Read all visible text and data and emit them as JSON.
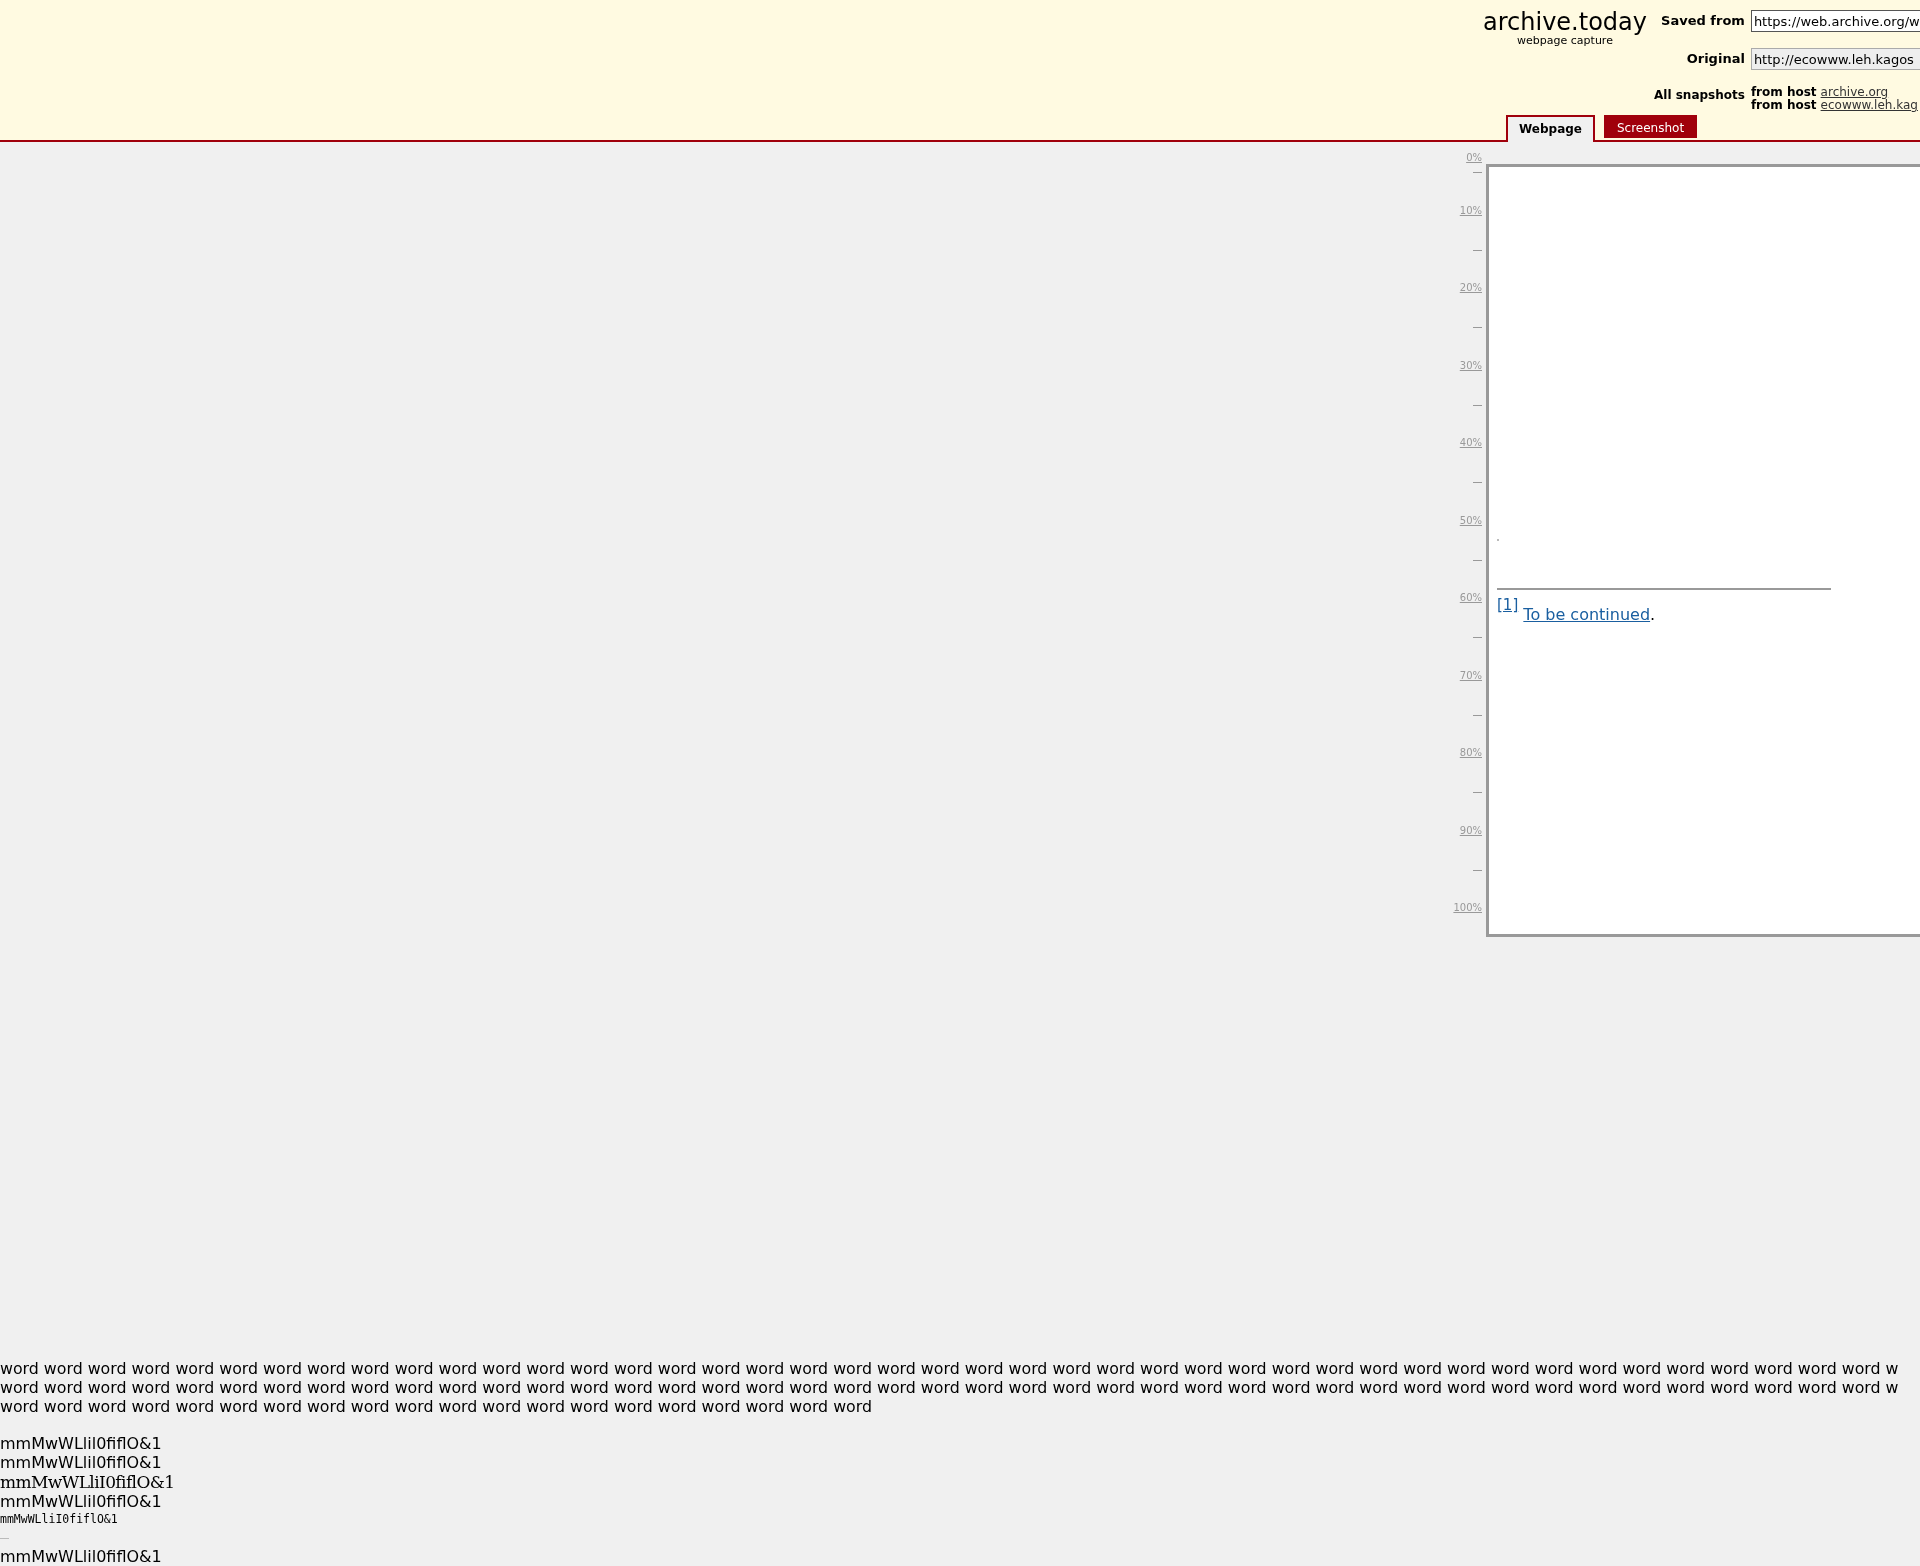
{
  "header": {
    "logo": "archive.today",
    "tagline": "webpage capture",
    "fields": [
      {
        "label": "Saved from",
        "value": "https://web.archive.org/w",
        "disabled": false
      },
      {
        "label": "Original",
        "value": "http://ecowww.leh.kagos",
        "disabled": true
      }
    ],
    "snapshots": {
      "label": "All snapshots",
      "hosts": [
        {
          "prefix": "from host",
          "link": "archive.org"
        },
        {
          "prefix": "from host",
          "link": "ecowww.leh.kag"
        }
      ]
    }
  },
  "tabs": [
    {
      "label": "Webpage",
      "selected": true
    },
    {
      "label": "Screenshot",
      "selected": false
    }
  ],
  "ruler": [
    "0%",
    "10%",
    "20%",
    "30%",
    "40%",
    "50%",
    "60%",
    "70%",
    "80%",
    "90%",
    "100%"
  ],
  "page": {
    "footnote_ref": "[1]",
    "footnote_link": "To be continued",
    "footnote_end": "."
  },
  "text_lines": [
    "word word word word word word word word word word word word word word word word word word word word word word word word word word word word word word word word word word word word word word word word word word word w",
    "word word word word word word word word word word word word word word word word word word word word word word word word word word word word word word word word word word word word word word word word word word word w",
    "word word word word word word word word word word word word word word word word word word word word"
  ],
  "font_samples": [
    {
      "kind": "sans",
      "text": "mmMwWLlil0fiflO&1"
    },
    {
      "kind": "sans",
      "text": "mmMwWLlil0fiflO&1"
    },
    {
      "kind": "serif",
      "text": "mmMwWLliI0fiflO&1"
    },
    {
      "kind": "sans",
      "text": "mmMwWLlil0fiflO&1"
    },
    {
      "kind": "mono",
      "text": "mmMwWLliI0fiflO&1"
    },
    {
      "kind": "rule"
    },
    {
      "kind": "sans",
      "text": "mmMwWLlil0fiflO&1"
    }
  ]
}
